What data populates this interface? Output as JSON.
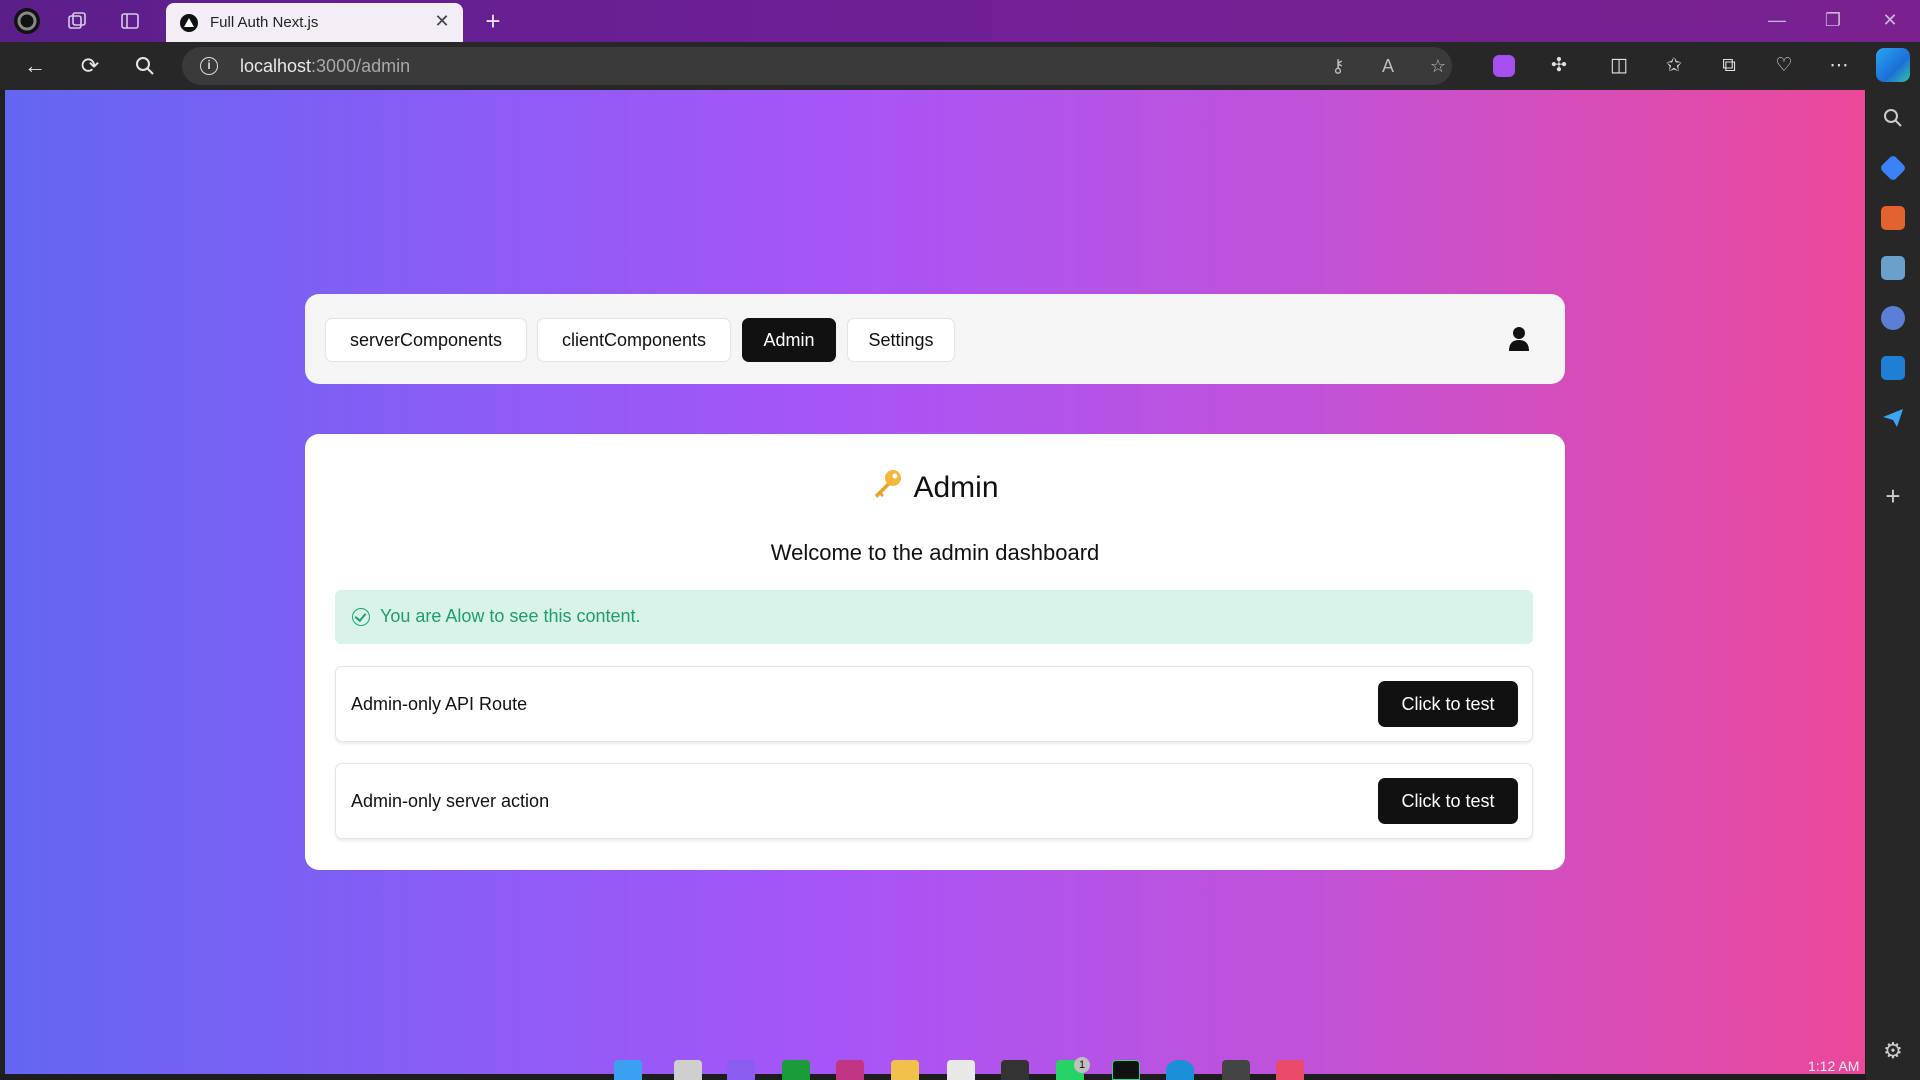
{
  "browser": {
    "tab_title": "Full Auth Next.js",
    "url_host": "localhost",
    "url_rest": ":3000/admin",
    "new_tab_symbol": "+",
    "close_symbol": "✕"
  },
  "nav": {
    "items": [
      {
        "label": "serverComponents",
        "active": false
      },
      {
        "label": "clientComponents",
        "active": false
      },
      {
        "label": "Admin",
        "active": true
      },
      {
        "label": "Settings",
        "active": false
      }
    ]
  },
  "card": {
    "title": "Admin",
    "title_icon": "key-icon",
    "subtitle": "Welcome to the admin dashboard",
    "alert": "You are Alow to see this content.",
    "rows": [
      {
        "label": "Admin-only API Route",
        "button": "Click to test"
      },
      {
        "label": "Admin-only server action",
        "button": "Click to test"
      }
    ]
  },
  "taskbar": {
    "clock": "1:12 AM",
    "badge_count": "1"
  },
  "colors": {
    "gradient_start": "#6366f1",
    "gradient_mid": "#a855f7",
    "gradient_end": "#ec4899",
    "alert_bg": "#d9f3ea",
    "alert_text": "#1f9d6a",
    "active_pill": "#111111"
  }
}
